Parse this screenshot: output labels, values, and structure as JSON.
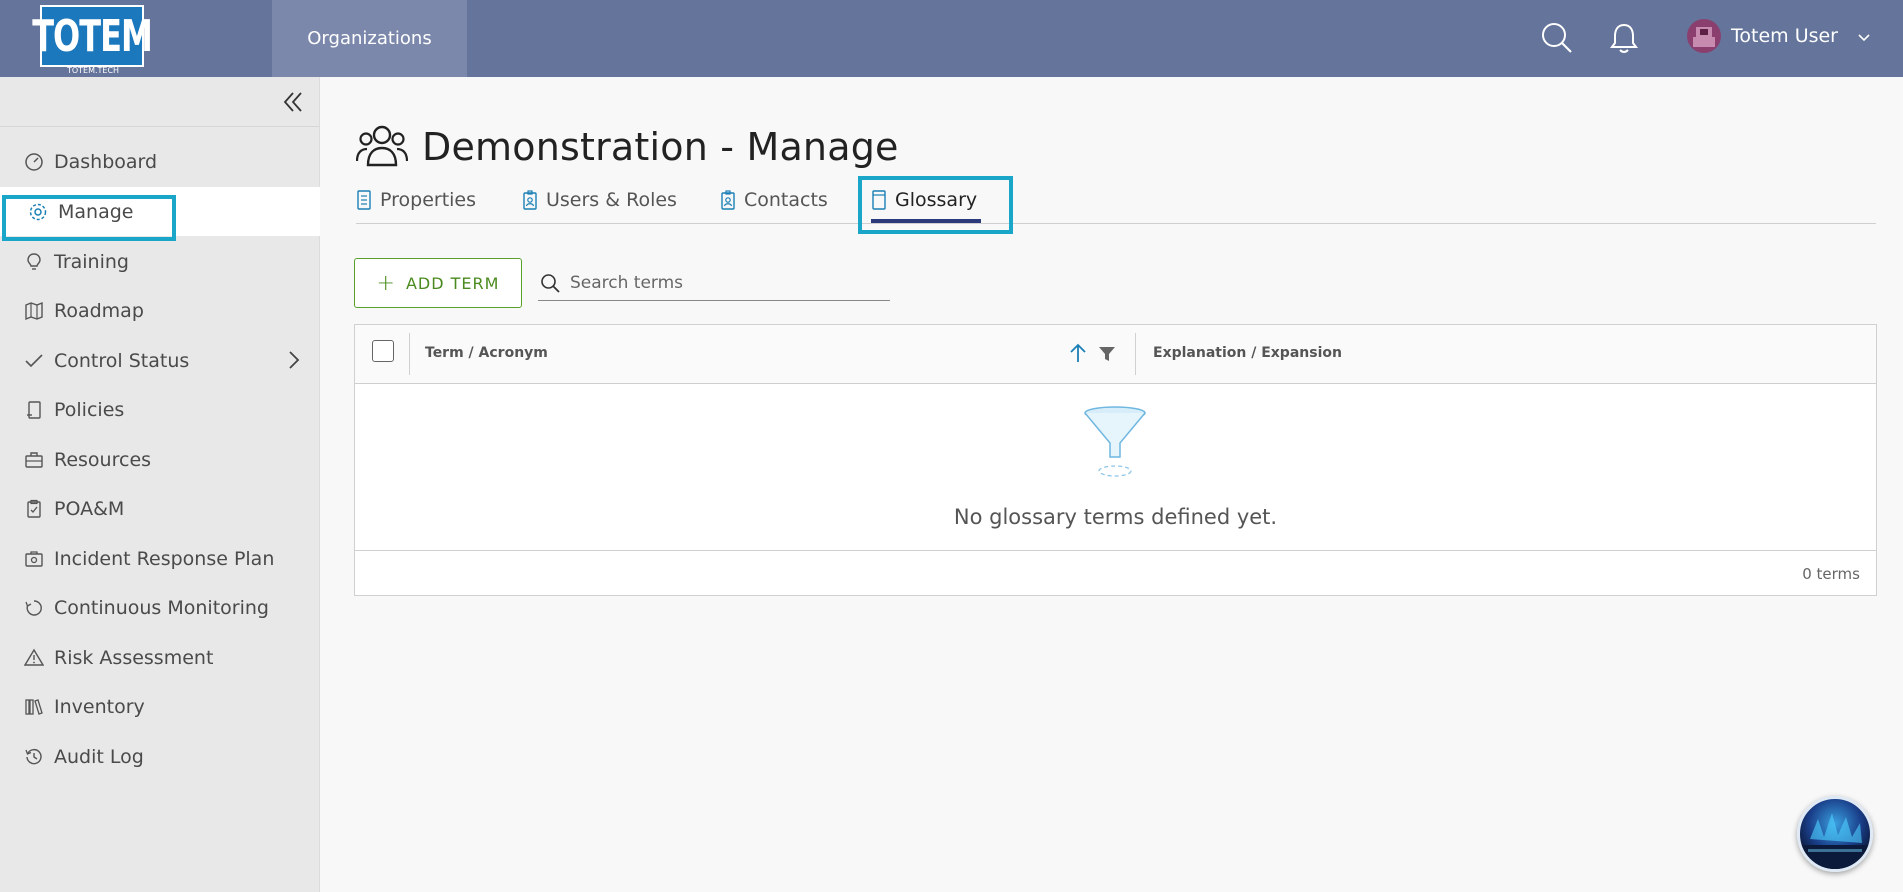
{
  "header": {
    "logo_text": "TOTEM",
    "logo_sub": "TOTEM.TECH",
    "nav_item": "Organizations",
    "user_name": "Totem User",
    "accent_color": "#64749a"
  },
  "sidebar": {
    "items": [
      {
        "label": "Dashboard",
        "icon": "dashboard-icon"
      },
      {
        "label": "Manage",
        "icon": "gear-icon"
      },
      {
        "label": "Training",
        "icon": "lightbulb-icon"
      },
      {
        "label": "Roadmap",
        "icon": "map-icon"
      },
      {
        "label": "Control Status",
        "icon": "check-icon"
      },
      {
        "label": "Policies",
        "icon": "scroll-icon"
      },
      {
        "label": "Resources",
        "icon": "briefcase-icon"
      },
      {
        "label": "POA&M",
        "icon": "clipboard-icon"
      },
      {
        "label": "Incident Response Plan",
        "icon": "first-aid-icon"
      },
      {
        "label": "Continuous Monitoring",
        "icon": "cycle-icon"
      },
      {
        "label": "Risk Assessment",
        "icon": "warning-icon"
      },
      {
        "label": "Inventory",
        "icon": "books-icon"
      },
      {
        "label": "Audit Log",
        "icon": "history-icon"
      }
    ]
  },
  "page": {
    "title": "Demonstration - Manage",
    "tabs": [
      {
        "label": "Properties"
      },
      {
        "label": "Users & Roles"
      },
      {
        "label": "Contacts"
      },
      {
        "label": "Glossary"
      }
    ]
  },
  "toolbar": {
    "add_label": "ADD TERM",
    "search_placeholder": "Search terms"
  },
  "grid": {
    "columns": [
      "Term / Acronym",
      "Explanation / Expansion"
    ],
    "empty_message": "No glossary terms defined yet.",
    "footer_count": "0 terms"
  }
}
